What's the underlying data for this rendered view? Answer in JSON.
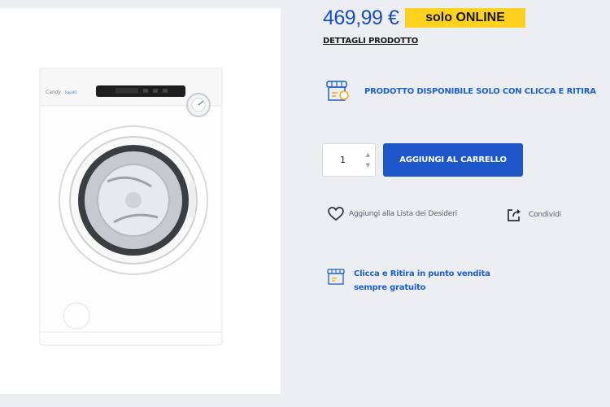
{
  "product": {
    "price": "469,99 €",
    "badge": {
      "prefix": "solo",
      "highlight": "ONLINE"
    },
    "details_link": "DETTAGLI PRODOTTO",
    "image_icon": "washing-machine-icon"
  },
  "availability": {
    "pickup_notice": "PRODOTTO DISPONIBILE SOLO CON CLICCA E RITIRA",
    "icon": "store-pickup-icon"
  },
  "cart": {
    "quantity": "1",
    "add_label": "AGGIUNGI AL CARRELLO"
  },
  "actions": {
    "wishlist_label": "Aggiungi alla Lista dei Desideri",
    "share_label": "Condividi",
    "wishlist_icon": "heart-icon",
    "share_icon": "share-icon"
  },
  "pickup_info": {
    "line1": "Clicca e Ritira in punto vendita",
    "line2": "sempre gratuito"
  },
  "colors": {
    "brand_blue": "#1c56c9",
    "link_blue": "#1b5fd0",
    "badge_yellow": "#ffd21f",
    "background": "#eceef1"
  }
}
